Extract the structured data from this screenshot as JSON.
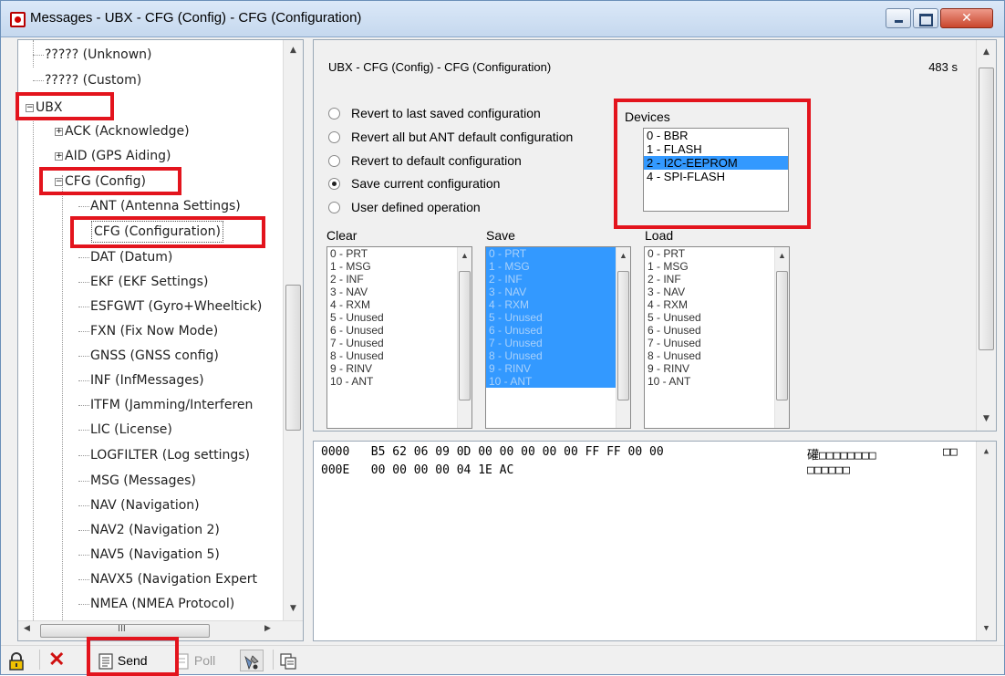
{
  "window": {
    "title": "Messages - UBX - CFG (Config) - CFG (Configuration)",
    "accent": "#e3141d"
  },
  "tree": {
    "items": [
      {
        "label": "????? (Unknown)"
      },
      {
        "label": "????? (Custom)"
      },
      {
        "label": "UBX",
        "expander": "−"
      },
      {
        "label": "ACK (Acknowledge)",
        "expander": "+"
      },
      {
        "label": "AID (GPS Aiding)",
        "expander": "+"
      },
      {
        "label": "CFG (Config)",
        "expander": "−"
      },
      {
        "label": "ANT (Antenna Settings)"
      },
      {
        "label": "CFG (Configuration)"
      },
      {
        "label": "DAT (Datum)"
      },
      {
        "label": "EKF (EKF Settings)"
      },
      {
        "label": "ESFGWT (Gyro+Wheeltick)"
      },
      {
        "label": "FXN (Fix Now Mode)"
      },
      {
        "label": "GNSS (GNSS config)"
      },
      {
        "label": "INF (InfMessages)"
      },
      {
        "label": "ITFM (Jamming/Interferen"
      },
      {
        "label": "LIC (License)"
      },
      {
        "label": "LOGFILTER (Log settings)"
      },
      {
        "label": "MSG (Messages)"
      },
      {
        "label": "NAV (Navigation)"
      },
      {
        "label": "NAV2 (Navigation 2)"
      },
      {
        "label": "NAV5 (Navigation 5)"
      },
      {
        "label": "NAVX5 (Navigation Expert"
      },
      {
        "label": "NMEA (NMEA Protocol)"
      }
    ],
    "hscroll_grip": "III"
  },
  "panel": {
    "title": "UBX - CFG (Config) - CFG (Configuration)",
    "age": "483 s",
    "options": [
      {
        "label": "Revert to last saved configuration",
        "selected": false
      },
      {
        "label": "Revert all but ANT default configuration",
        "selected": false
      },
      {
        "label": "Revert to default configuration",
        "selected": false
      },
      {
        "label": "Save current configuration",
        "selected": true
      },
      {
        "label": "User defined operation",
        "selected": false
      }
    ],
    "devices_label": "Devices",
    "devices": [
      "0 - BBR",
      "1 - FLASH",
      "2 - I2C-EEPROM",
      "4 - SPI-FLASH"
    ],
    "devices_highlight": "2 - I2C-EEPROM",
    "clear_label": "Clear",
    "save_label": "Save",
    "load_label": "Load",
    "sections": [
      "0 - PRT",
      "1 - MSG",
      "2 - INF",
      "3 - NAV",
      "4 - RXM",
      "5 - Unused",
      "6 - Unused",
      "7 - Unused",
      "8 - Unused",
      "9 - RINV",
      "10 - ANT"
    ]
  },
  "hex": {
    "rows": [
      {
        "offset": "0000",
        "bytes": "B5 62 06 09 0D 00 00 00 00 00 FF FF 00 00",
        "ascii": "礶□□□□□□□□",
        "ascii2": "□□"
      },
      {
        "offset": "000E",
        "bytes": "00 00 00 00 04 1E AC",
        "ascii": "□□□□□□",
        "ascii2": ""
      }
    ]
  },
  "toolbar": {
    "send_label": "Send",
    "poll_label": "Poll"
  }
}
